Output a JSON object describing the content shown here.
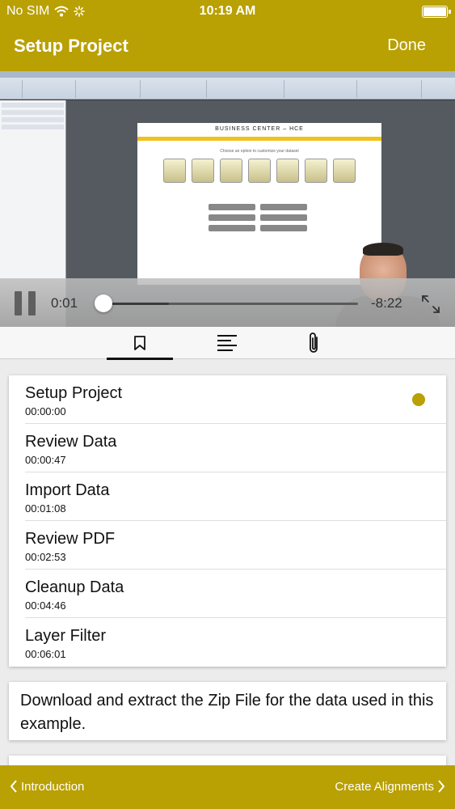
{
  "status_bar": {
    "carrier": "No SIM",
    "time": "10:19 AM"
  },
  "nav": {
    "title": "Setup Project",
    "done_label": "Done"
  },
  "player": {
    "current_time": "0:01",
    "remaining_time": "-8:22",
    "progress_fraction": 0.002,
    "buffered_fraction": 0.26,
    "state": "playing"
  },
  "video_frame": {
    "heading": "BUSINESS CENTER – HCE",
    "caption": "Choose an option to customize your dataset"
  },
  "tabs": [
    {
      "icon": "bookmark-icon",
      "selected": true
    },
    {
      "icon": "text-lines-icon",
      "selected": false
    },
    {
      "icon": "paperclip-icon",
      "selected": false
    }
  ],
  "chapters": [
    {
      "name": "Setup Project",
      "time": "00:00:00",
      "current": true
    },
    {
      "name": "Review Data",
      "time": "00:00:47",
      "current": false
    },
    {
      "name": "Import Data",
      "time": "00:01:08",
      "current": false
    },
    {
      "name": "Review PDF",
      "time": "00:02:53",
      "current": false
    },
    {
      "name": "Cleanup Data",
      "time": "00:04:46",
      "current": false
    },
    {
      "name": "Layer Filter",
      "time": "00:06:01",
      "current": false
    }
  ],
  "note": "Download and extract the Zip File for the data used in this example.",
  "footer": {
    "prev_label": "Introduction",
    "next_label": "Create Alignments"
  },
  "colors": {
    "accent": "#b9a003"
  }
}
